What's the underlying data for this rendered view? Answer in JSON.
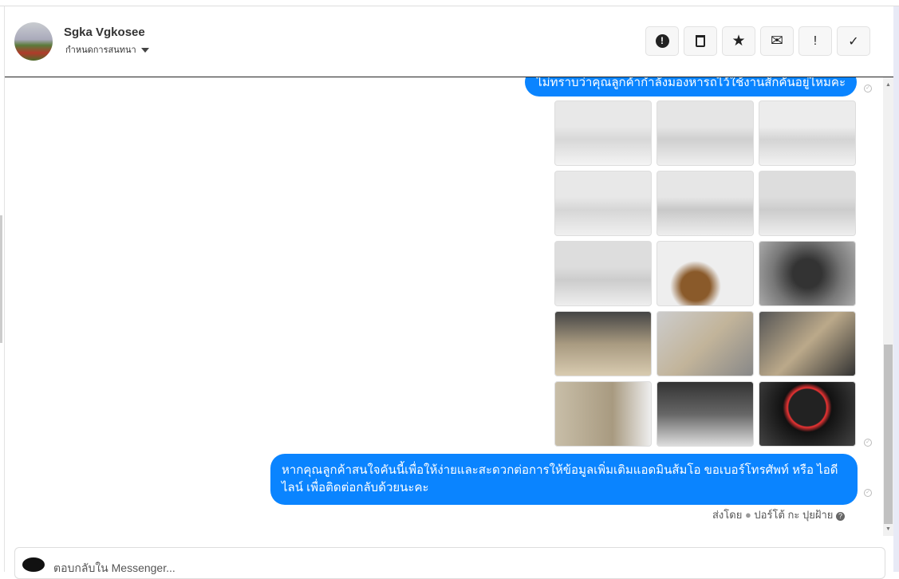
{
  "header": {
    "name": "Sgka Vgkosee",
    "subtitle": "กำหนดการสนทนา",
    "actions": [
      {
        "icon": "exclamation-circle-icon",
        "glyph": "❗"
      },
      {
        "icon": "trash-icon",
        "glyph": "🗑"
      },
      {
        "icon": "star-icon",
        "glyph": "★"
      },
      {
        "icon": "envelope-icon",
        "glyph": "✉"
      },
      {
        "icon": "exclamation-icon",
        "glyph": "!"
      },
      {
        "icon": "check-icon",
        "glyph": "✓"
      }
    ]
  },
  "messages": [
    {
      "text": "ไม่ทราบว่าคุณลูกค้ากำลังมองหารถไว้ใช้งานสักคันอยู่ไหมคะ"
    },
    {
      "text": "หากคุณลูกค้าสนใจคันนี้เพื่อให้ง่ายและสะดวกต่อการให้ข้อมูลเพิ่มเติมแอดมินส้มโอ ขอเบอร์โทรศัพท์ หรือ ไอดีไลน์ เพื่อติดต่อกลับด้วยนะคะ"
    }
  ],
  "sent_by": {
    "prefix": "ส่งโดย",
    "name": "ปอร์โต้ กะ ปุยฝ้าย"
  },
  "photos": [
    "exterior-front",
    "exterior-front-angle",
    "exterior-rear",
    "exterior-rear-2",
    "exterior-rear-angle",
    "exterior-side",
    "exterior-side-2",
    "wheel",
    "steering-wheel",
    "dashboard",
    "front-seat",
    "rear-seat",
    "door-panel",
    "engine",
    "gauge-cluster"
  ],
  "reply": {
    "placeholder": "ตอบกลับใน Messenger..."
  }
}
